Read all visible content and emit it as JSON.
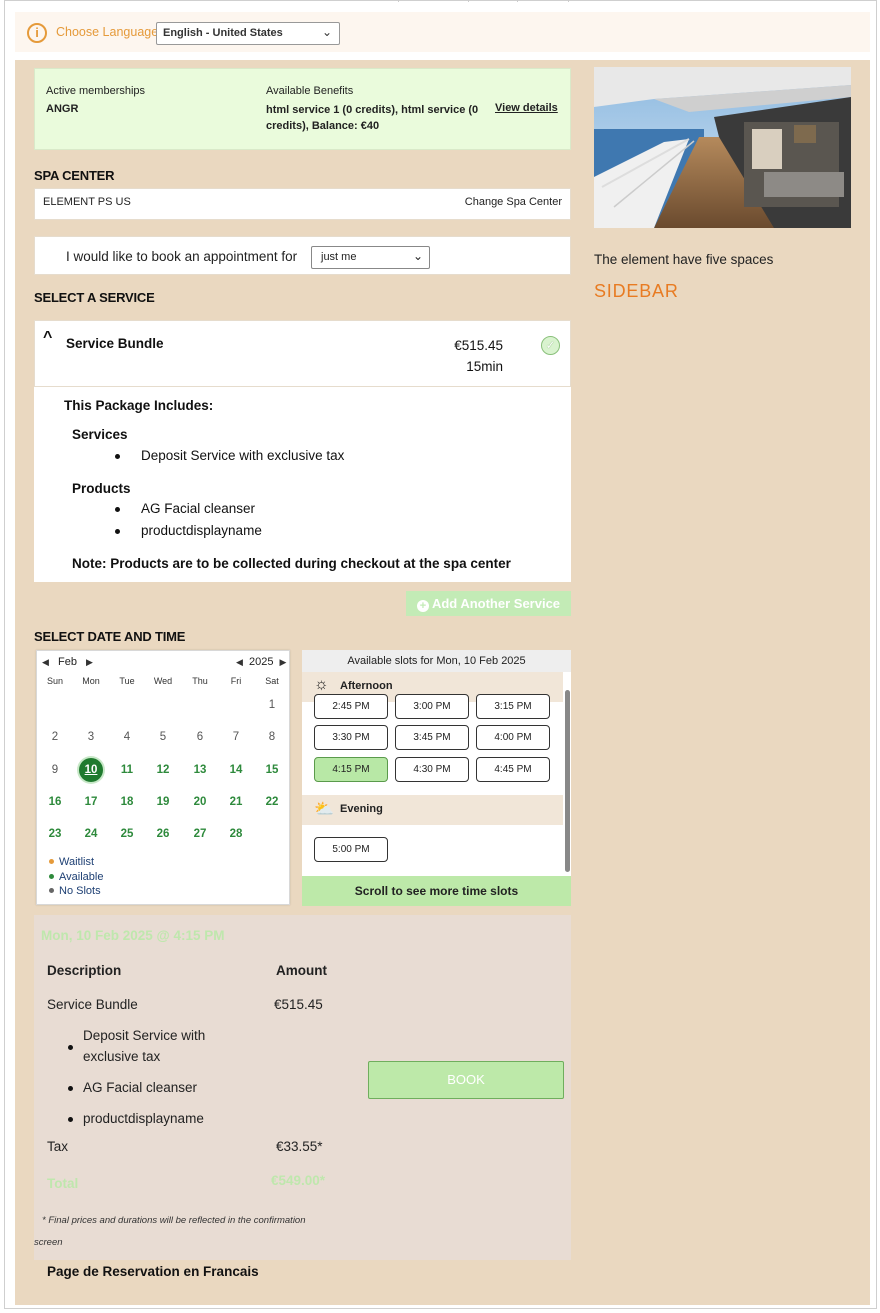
{
  "language": {
    "label": "Choose Language",
    "selected": "English - United States"
  },
  "membership": {
    "active_label": "Active memberships",
    "active_value": "ANGR",
    "benefits_label": "Available Benefits",
    "benefits_line1": "html service 1 (0 credits), html service (0",
    "benefits_line2": "credits), Balance: €40",
    "view_details": "View details"
  },
  "spa_center": {
    "heading": "SPA CENTER",
    "name": "ELEMENT PS US",
    "change": "Change Spa Center"
  },
  "book_for": {
    "text": "I would like to book an appointment for",
    "selected": "just me"
  },
  "select_service": {
    "heading": "SELECT A SERVICE",
    "service_name": "Service Bundle",
    "price": "€515.45",
    "duration": "15min",
    "package_includes": "This Package Includes:",
    "services_label": "Services",
    "services": [
      "Deposit Service with exclusive tax"
    ],
    "products_label": "Products",
    "products": [
      "AG Facial cleanser",
      "productdisplayname"
    ],
    "note": "Note: Products are to be collected during checkout at the spa center",
    "add_another": "Add Another Service"
  },
  "date_time": {
    "heading": "SELECT DATE AND TIME",
    "month": "Feb",
    "year": "2025",
    "weekdays": [
      "Sun",
      "Mon",
      "Tue",
      "Wed",
      "Thu",
      "Fri",
      "Sat"
    ],
    "today": "10",
    "legend": [
      "Waitlist",
      "Available",
      "No Slots"
    ],
    "legend_colors": [
      "#e59a3a",
      "#2e8a3c",
      "#666666"
    ],
    "slots_header": "Available slots for Mon, 10 Feb 2025",
    "afternoon_label": "Afternoon",
    "afternoon_slots": [
      "2:45 PM",
      "3:00 PM",
      "3:15 PM",
      "3:30 PM",
      "3:45 PM",
      "4:00 PM",
      "4:15 PM",
      "4:30 PM",
      "4:45 PM"
    ],
    "selected_slot": "4:15 PM",
    "evening_label": "Evening",
    "evening_slots": [
      "5:00 PM"
    ],
    "scroll_hint": "Scroll to see more time slots"
  },
  "summary": {
    "selected_datetime": "Mon, 10 Feb 2025 @ 4:15 PM",
    "col_description": "Description",
    "col_amount": "Amount",
    "item_name": "Service Bundle",
    "item_amount": "€515.45",
    "item_sub1a": "Deposit Service with",
    "item_sub1b": "exclusive tax",
    "item_sub2": "AG Facial cleanser",
    "item_sub3": "productdisplayname",
    "tax_label": "Tax",
    "tax_amount": "€33.55*",
    "total_label": "Total",
    "total_amount": "€549.00*",
    "book": "BOOK",
    "note_line1": "* Final prices and durations will be reflected in the confirmation",
    "note_line2": "screen"
  },
  "french_link": "Page de Reservation en Francais",
  "sidebar": {
    "text": "The element have five spaces",
    "title": "SIDEBAR"
  },
  "colors": {
    "accent_orange": "#e59a3a",
    "page_beige": "#ead8c0",
    "available_green": "#2e8a3c",
    "button_green": "#bde9a9"
  }
}
